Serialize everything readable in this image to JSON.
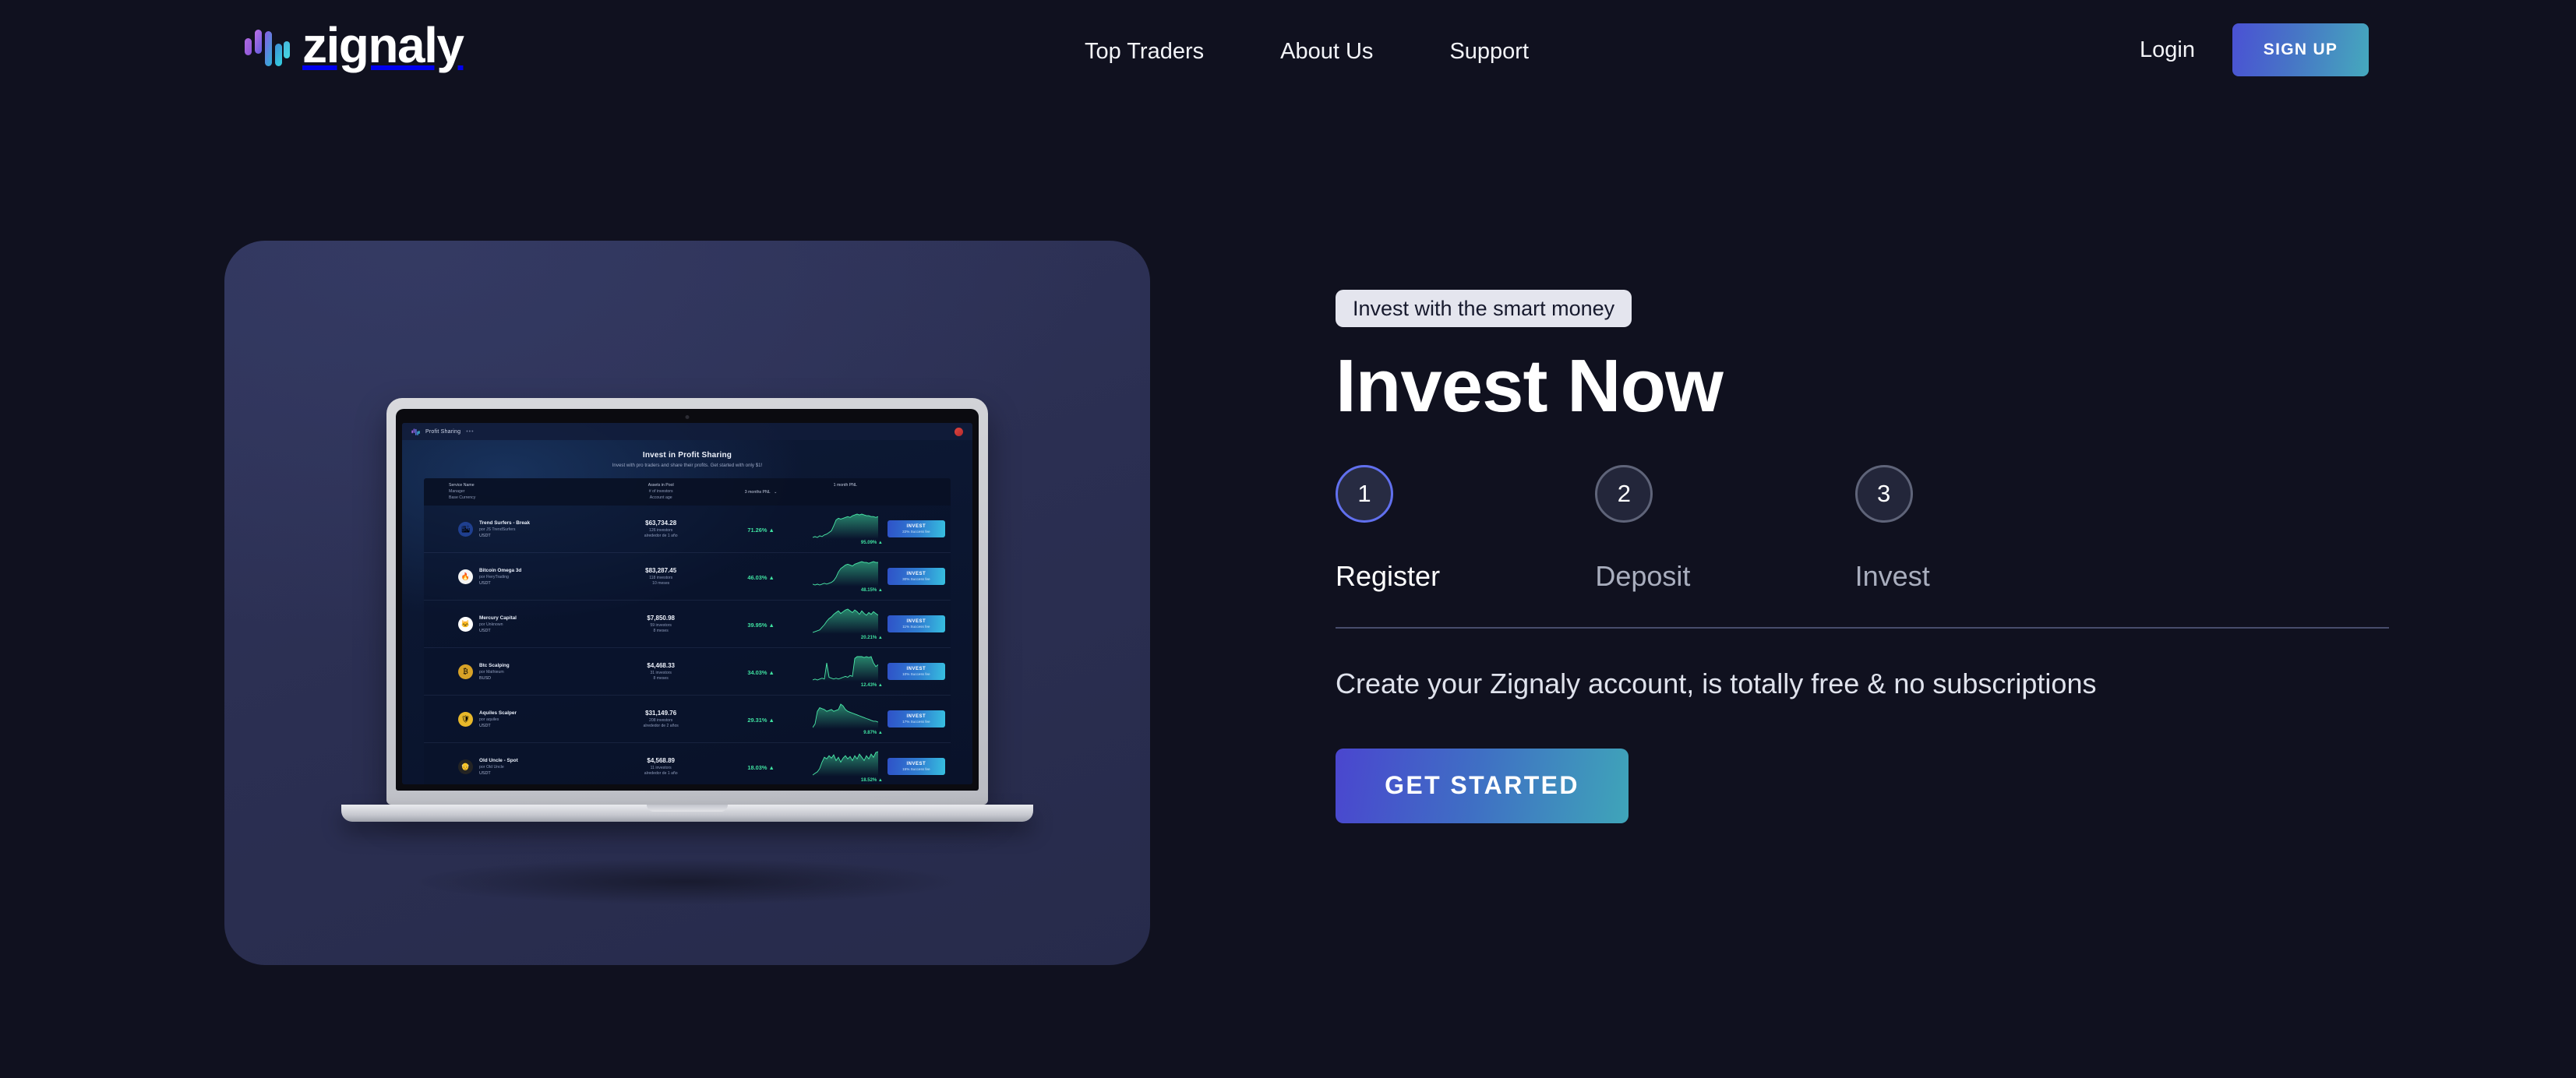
{
  "brand": {
    "name": "zignaly",
    "logo_icon": "zignaly-bars-logo"
  },
  "nav": {
    "links": [
      {
        "label": "Top Traders"
      },
      {
        "label": "About Us"
      },
      {
        "label": "Support"
      }
    ],
    "login_label": "Login",
    "signup_label": "SIGN UP"
  },
  "hero": {
    "eyebrow": "Invest with the smart money",
    "title": "Invest Now",
    "description": "Create your Zignaly account, is totally free & no subscriptions",
    "cta_label": "GET STARTED",
    "steps": [
      {
        "number": "1",
        "label": "Register",
        "active": true
      },
      {
        "number": "2",
        "label": "Deposit",
        "active": false
      },
      {
        "number": "3",
        "label": "Invest",
        "active": false
      }
    ]
  },
  "mockup": {
    "app": {
      "topbar": {
        "logo_icon": "zignaly-bars-logo",
        "title": "Profit Sharing",
        "menu_dots": "•••",
        "avatar_icon": "user-avatar"
      },
      "heading": "Invest in Profit Sharing",
      "subheading": "Invest with pro traders and share their profits. Get started with only $1!",
      "columns": {
        "service": [
          "Service Name",
          "Manager",
          "Base Currency"
        ],
        "assets": [
          "Assets in Pool",
          "# of investors",
          "Account age"
        ],
        "pnl3": "3 months PNL",
        "pnl1": "1 month PNL",
        "sort_icon": "chevron-down-icon"
      },
      "rows": [
        {
          "avatar_icon": "trend-surfers-logo",
          "avatar_bg": "#1f3f8f",
          "avatar_glyph": "🏙",
          "name": "Trend Surfers - Break",
          "manager": "por JS TrendSurfers",
          "currency": "USDT",
          "assets": "$63,734.28",
          "investors": "126 investors",
          "age": "alrededor de 1 año",
          "pnl3": "71.26%",
          "pnl1": "95.09%",
          "invest_label": "INVEST",
          "invest_fee": "22% Success fee",
          "spark": [
            30,
            29,
            30,
            28,
            29,
            27,
            26,
            24,
            22,
            16,
            9,
            7,
            8,
            7,
            6,
            5,
            6,
            4,
            3,
            2,
            3,
            2,
            3,
            4,
            4,
            5,
            5,
            6,
            5
          ]
        },
        {
          "avatar_icon": "bitcoin-omega-logo",
          "avatar_bg": "#f4f4f4",
          "avatar_glyph": "🔥",
          "name": "Bitcoin Omega 3d",
          "manager": "por FieryTrading",
          "currency": "USDT",
          "assets": "$83,287.45",
          "investors": "118 investors",
          "age": "10 meses",
          "pnl3": "46.03%",
          "pnl1": "48.15%",
          "invest_label": "INVEST",
          "invest_fee": "30% Success fee",
          "spark": [
            28,
            29,
            28,
            29,
            28,
            27,
            28,
            27,
            26,
            24,
            20,
            14,
            10,
            8,
            6,
            5,
            6,
            7,
            5,
            4,
            3,
            2,
            3,
            3,
            4,
            3,
            2,
            3,
            3
          ]
        },
        {
          "avatar_icon": "mercury-capital-logo",
          "avatar_bg": "#ffffff",
          "avatar_glyph": "🐱",
          "name": "Mercury Capital",
          "manager": "por Unknown",
          "currency": "USDT",
          "assets": "$7,850.98",
          "investors": "59 investors",
          "age": "8 meses",
          "pnl3": "39.95%",
          "pnl1": "20.21%",
          "invest_label": "INVEST",
          "invest_fee": "11% Success fee",
          "spark": [
            30,
            29,
            28,
            27,
            24,
            21,
            17,
            14,
            12,
            9,
            7,
            5,
            8,
            6,
            4,
            3,
            5,
            7,
            4,
            6,
            9,
            5,
            8,
            10,
            7,
            9,
            6,
            8,
            10
          ]
        },
        {
          "avatar_icon": "btc-scalping-logo",
          "avatar_bg": "#d8a227",
          "avatar_glyph": "₿",
          "name": "Btc Scalping",
          "manager": "por Mathieum",
          "currency": "BUSD",
          "assets": "$4,468.33",
          "investors": "31 investors",
          "age": "8 meses",
          "pnl3": "34.03%",
          "pnl1": "12.43%",
          "invest_label": "INVEST",
          "invest_fee": "10% Success fee",
          "spark": [
            29,
            28,
            29,
            28,
            27,
            28,
            10,
            26,
            27,
            28,
            27,
            28,
            27,
            26,
            25,
            26,
            24,
            25,
            5,
            3,
            3,
            3,
            4,
            3,
            4,
            3,
            10,
            14,
            12
          ]
        },
        {
          "avatar_icon": "aquiles-scalper-logo",
          "avatar_bg": "#e8b82a",
          "avatar_glyph": "🛡",
          "name": "Aquiles Scalper",
          "manager": "por aquiles",
          "currency": "USDT",
          "assets": "$31,149.76",
          "investors": "208 investors",
          "age": "alrededor de 2 años",
          "pnl3": "29.31%",
          "pnl1": "9.87%",
          "invest_label": "INVEST",
          "invest_fee": "17% Success fee",
          "spark": [
            30,
            26,
            12,
            8,
            9,
            10,
            12,
            11,
            10,
            12,
            11,
            10,
            4,
            6,
            10,
            12,
            13,
            14,
            15,
            16,
            17,
            18,
            19,
            20,
            21,
            22,
            23,
            23,
            24
          ]
        },
        {
          "avatar_icon": "old-uncle-logo",
          "avatar_bg": "#242424",
          "avatar_glyph": "👴",
          "name": "Old Uncle - Spot",
          "manager": "por Old Uncle",
          "currency": "USDT",
          "assets": "$4,568.89",
          "investors": "11 investors",
          "age": "alrededor de 1 año",
          "pnl3": "18.03%",
          "pnl1": "18.52%",
          "invest_label": "INVEST",
          "invest_fee": "15% Success fee",
          "spark": [
            30,
            28,
            26,
            22,
            14,
            8,
            10,
            6,
            9,
            5,
            12,
            8,
            14,
            9,
            6,
            10,
            7,
            12,
            6,
            10,
            4,
            8,
            12,
            6,
            10,
            4,
            8,
            2,
            1
          ]
        }
      ]
    }
  },
  "colors": {
    "page_bg": "#10111f",
    "card_bg": "#2d3156",
    "accent_purple": "#6170ee",
    "accent_teal": "#3fa5b9",
    "profit_green": "#3fe0a0"
  }
}
